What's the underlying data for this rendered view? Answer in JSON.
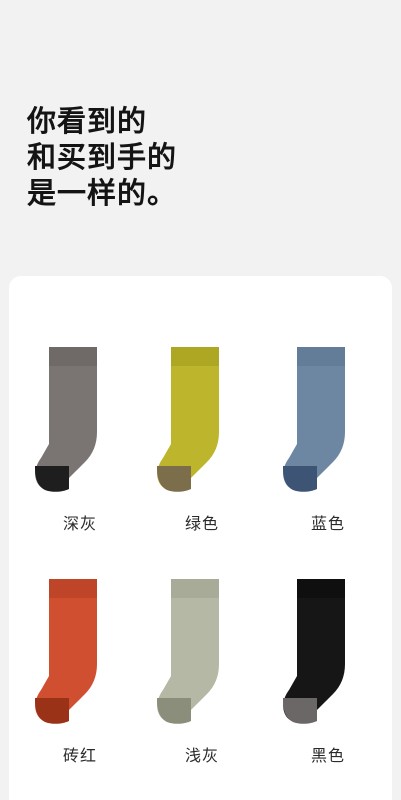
{
  "headline": {
    "lines": [
      "你看到的",
      "和买到手的",
      "是一样的。"
    ]
  },
  "colors": [
    {
      "name": "深灰",
      "body": "#7a7572",
      "cuff": "#6f6a67",
      "toe": "#1e1e1e",
      "icon": "sock-icon"
    },
    {
      "name": "绿色",
      "body": "#bdb52c",
      "cuff": "#aea723",
      "toe": "#7c6e4a",
      "icon": "sock-icon"
    },
    {
      "name": "蓝色",
      "body": "#6d87a3",
      "cuff": "#637c97",
      "toe": "#3d5475",
      "icon": "sock-icon"
    },
    {
      "name": "砖红",
      "body": "#cf4f30",
      "cuff": "#bf4528",
      "toe": "#9a3218",
      "icon": "sock-icon"
    },
    {
      "name": "浅灰",
      "body": "#b6b8a6",
      "cuff": "#a9ab99",
      "toe": "#8c8e7c",
      "icon": "sock-icon"
    },
    {
      "name": "黑色",
      "body": "#161616",
      "cuff": "#0f0f0f",
      "toe": "#6b6766",
      "icon": "sock-icon"
    }
  ]
}
